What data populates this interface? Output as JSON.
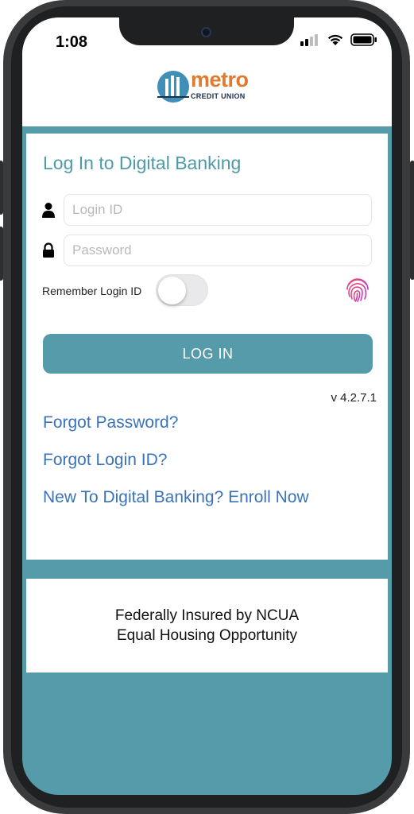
{
  "status_bar": {
    "time": "1:08"
  },
  "brand": {
    "name": "metro",
    "subtitle": "CREDIT UNION"
  },
  "login": {
    "title": "Log In to Digital Banking",
    "login_id_placeholder": "Login ID",
    "password_placeholder": "Password",
    "remember_label": "Remember Login ID",
    "remember_on": false,
    "button_label": "LOG IN",
    "version": "v 4.2.7.1",
    "links": [
      "Forgot Password?",
      "Forgot Login ID?",
      "New To Digital Banking? Enroll Now"
    ]
  },
  "footer": {
    "line1": "Federally Insured by NCUA",
    "line2": "Equal Housing Opportunity"
  },
  "colors": {
    "accent": "#559ba9",
    "link": "#3a73b8",
    "brand_orange": "#e07a2f",
    "title": "#4e9aa8"
  },
  "icons": [
    "cellular-signal-icon",
    "wifi-icon",
    "battery-icon",
    "user-icon",
    "lock-icon",
    "fingerprint-icon"
  ]
}
